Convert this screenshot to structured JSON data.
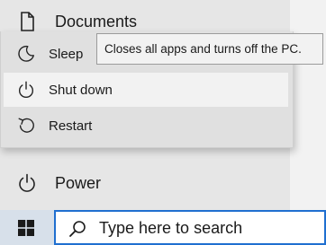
{
  "start_menu": {
    "documents_label": "Documents",
    "power_label": "Power"
  },
  "power_flyout": {
    "items": [
      {
        "label": "Sleep",
        "icon": "sleep-icon"
      },
      {
        "label": "Shut down",
        "icon": "power-icon",
        "highlighted": true
      },
      {
        "label": "Restart",
        "icon": "restart-icon"
      }
    ]
  },
  "tooltip": {
    "text": "Closes all apps and turns off the PC."
  },
  "taskbar": {
    "start_icon": "windows-logo-icon",
    "search_placeholder": "Type here to search",
    "search_icon": "search-icon",
    "accent_color": "#1f6fd0"
  }
}
